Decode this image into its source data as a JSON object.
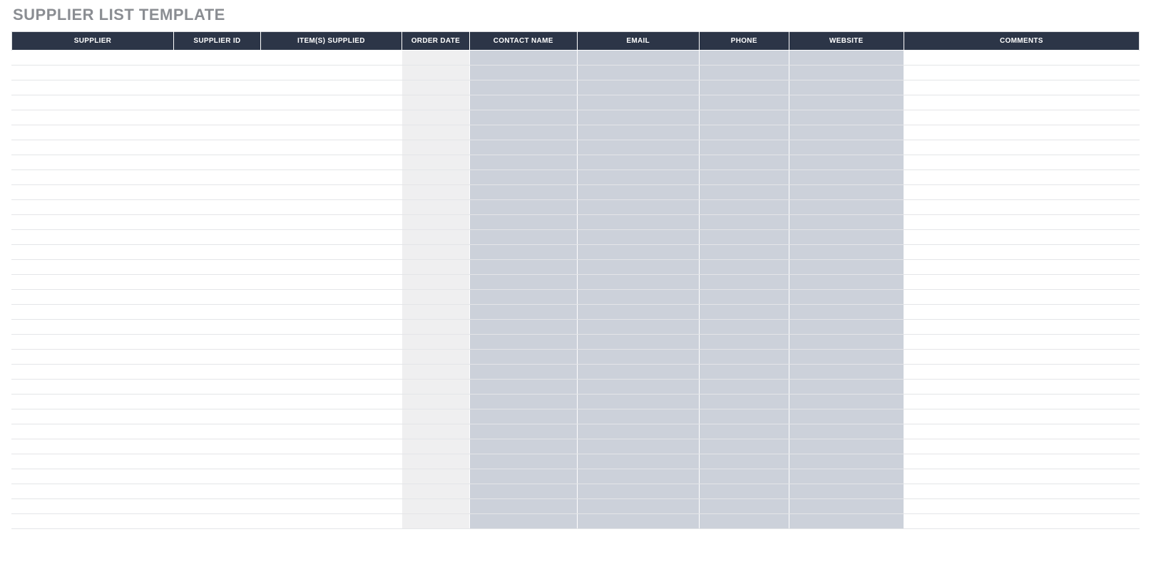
{
  "title": "SUPPLIER LIST TEMPLATE",
  "table": {
    "columns": [
      {
        "key": "supplier",
        "label": "SUPPLIER",
        "shaded": false,
        "special": null
      },
      {
        "key": "supplier_id",
        "label": "SUPPLIER ID",
        "shaded": false,
        "special": null
      },
      {
        "key": "items",
        "label": "ITEM(S) SUPPLIED",
        "shaded": false,
        "special": null
      },
      {
        "key": "order_date",
        "label": "ORDER DATE",
        "shaded": false,
        "special": "order-date"
      },
      {
        "key": "contact",
        "label": "CONTACT NAME",
        "shaded": true,
        "special": null
      },
      {
        "key": "email",
        "label": "EMAIL",
        "shaded": true,
        "special": null
      },
      {
        "key": "phone",
        "label": "PHONE",
        "shaded": true,
        "special": null
      },
      {
        "key": "website",
        "label": "WEBSITE",
        "shaded": true,
        "special": null
      },
      {
        "key": "comments",
        "label": "COMMENTS",
        "shaded": false,
        "special": null
      }
    ],
    "row_count": 32,
    "rows": []
  },
  "colors": {
    "header_bg": "#2c3547",
    "shaded_bg": "#ccd1da",
    "orderdate_bg": "#efeff0",
    "title_color": "#8a8d92"
  }
}
